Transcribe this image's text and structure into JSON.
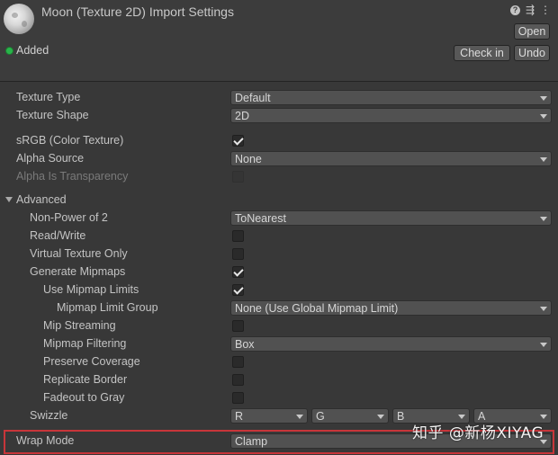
{
  "header": {
    "title": "Moon (Texture 2D) Import Settings",
    "open_label": "Open",
    "status": "Added",
    "check_in_label": "Check in",
    "undo_label": "Undo",
    "icons": [
      "help-icon",
      "preset-sliders-icon",
      "kebab-menu-icon"
    ]
  },
  "settings": {
    "texture_type": {
      "label": "Texture Type",
      "value": "Default"
    },
    "texture_shape": {
      "label": "Texture Shape",
      "value": "2D"
    },
    "srgb": {
      "label": "sRGB (Color Texture)",
      "checked": true
    },
    "alpha_source": {
      "label": "Alpha Source",
      "value": "None"
    },
    "alpha_is_transparency": {
      "label": "Alpha Is Transparency",
      "checked": false,
      "disabled": true
    },
    "advanced": {
      "label": "Advanced",
      "expanded": true
    },
    "non_power_of_2": {
      "label": "Non-Power of 2",
      "value": "ToNearest"
    },
    "read_write": {
      "label": "Read/Write",
      "checked": false
    },
    "virtual_texture_only": {
      "label": "Virtual Texture Only",
      "checked": false
    },
    "generate_mipmaps": {
      "label": "Generate Mipmaps",
      "checked": true
    },
    "use_mipmap_limits": {
      "label": "Use Mipmap Limits",
      "checked": true
    },
    "mipmap_limit_group": {
      "label": "Mipmap Limit Group",
      "value": "None (Use Global Mipmap Limit)"
    },
    "mip_streaming": {
      "label": "Mip Streaming",
      "checked": false
    },
    "mipmap_filtering": {
      "label": "Mipmap Filtering",
      "value": "Box"
    },
    "preserve_coverage": {
      "label": "Preserve Coverage",
      "checked": false
    },
    "replicate_border": {
      "label": "Replicate Border",
      "checked": false
    },
    "fadeout_to_gray": {
      "label": "Fadeout to Gray",
      "checked": false
    },
    "swizzle": {
      "label": "Swizzle",
      "r": "R",
      "g": "G",
      "b": "B",
      "a": "A"
    },
    "wrap_mode": {
      "label": "Wrap Mode",
      "value": "Clamp"
    }
  },
  "watermark": "知乎 @新杨XIYAG",
  "colors": {
    "highlight": "#c8353a",
    "status": "#28b44a"
  }
}
